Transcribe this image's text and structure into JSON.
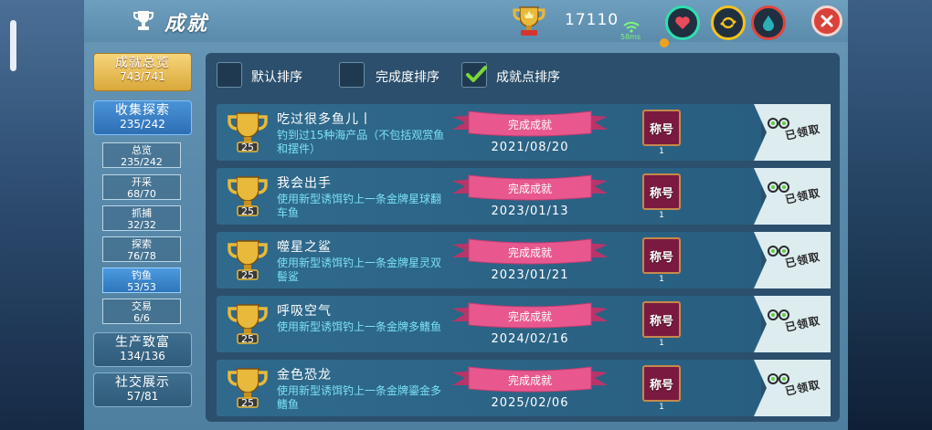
{
  "header": {
    "title": "成就",
    "score": "17110",
    "ping": "58ms",
    "icons": [
      "trophy-icon",
      "heart-icon",
      "power-icon",
      "drop-icon",
      "close-icon"
    ]
  },
  "nav": {
    "overview": {
      "label": "成就总览",
      "count": "743/741"
    },
    "explore": {
      "label": "收集探索",
      "count": "235/242"
    },
    "subs": [
      {
        "label": "总览",
        "count": "235/242"
      },
      {
        "label": "开采",
        "count": "68/70"
      },
      {
        "label": "抓捕",
        "count": "32/32"
      },
      {
        "label": "探索",
        "count": "76/78"
      },
      {
        "label": "钓鱼",
        "count": "53/53"
      },
      {
        "label": "交易",
        "count": "6/6"
      }
    ],
    "production": {
      "label": "生产致富",
      "count": "134/136"
    },
    "social": {
      "label": "社交展示",
      "count": "57/81"
    }
  },
  "sort": {
    "options": [
      {
        "label": "默认排序",
        "checked": false
      },
      {
        "label": "完成度排序",
        "checked": false
      },
      {
        "label": "成就点排序",
        "checked": true
      }
    ]
  },
  "achievements": [
    {
      "points": "25",
      "name": "吃过很多鱼儿丨",
      "desc": "钓到过15种海产品（不包括观赏鱼和摆件）",
      "status": "完成成就",
      "date": "2021/08/20",
      "badge": "称号",
      "badge_count": "1",
      "claim": "已领取"
    },
    {
      "points": "25",
      "name": "我会出手",
      "desc": "使用新型诱饵钓上一条金牌星球翻车鱼",
      "status": "完成成就",
      "date": "2023/01/13",
      "badge": "称号",
      "badge_count": "1",
      "claim": "已领取"
    },
    {
      "points": "25",
      "name": "噬星之鲨",
      "desc": "使用新型诱饵钓上一条金牌星灵双髻鲨",
      "status": "完成成就",
      "date": "2023/01/21",
      "badge": "称号",
      "badge_count": "1",
      "claim": "已领取"
    },
    {
      "points": "25",
      "name": "呼吸空气",
      "desc": "使用新型诱饵钓上一条金牌多鳍鱼",
      "status": "完成成就",
      "date": "2024/02/16",
      "badge": "称号",
      "badge_count": "1",
      "claim": "已领取"
    },
    {
      "points": "25",
      "name": "金色恐龙",
      "desc": "使用新型诱饵钓上一条金牌鎏金多鳍鱼",
      "status": "完成成就",
      "date": "2025/02/06",
      "badge": "称号",
      "badge_count": "1",
      "claim": "已领取"
    }
  ],
  "colors": {
    "panel": "#5a8aab",
    "row": "#2f6a8d",
    "ribbon": "#e8588e",
    "desc": "#7be1f5",
    "gold": "#e0b238",
    "close": "#d9423a"
  }
}
